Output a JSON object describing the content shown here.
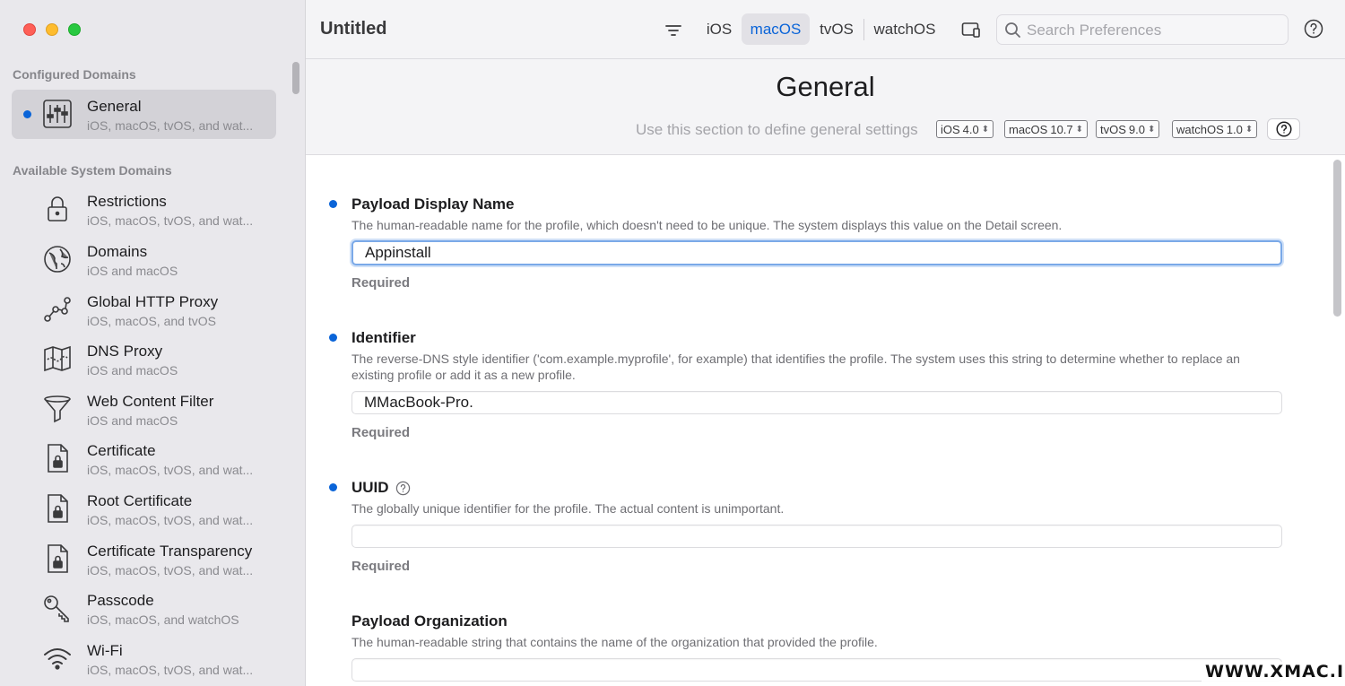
{
  "window": {
    "title": "Untitled"
  },
  "toolbar": {
    "tabs": [
      {
        "label": "iOS",
        "active": false
      },
      {
        "label": "macOS",
        "active": true
      },
      {
        "label": "tvOS",
        "active": false
      },
      {
        "label": "watchOS",
        "active": false
      }
    ],
    "search": {
      "placeholder": "Search Preferences",
      "value": ""
    }
  },
  "sidebar": {
    "configured_heading": "Configured Domains",
    "configured": [
      {
        "title": "General",
        "subtitle": "iOS, macOS, tvOS, and wat...",
        "icon": "sliders-icon",
        "selected": true
      }
    ],
    "available_heading": "Available System Domains",
    "available": [
      {
        "title": "Restrictions",
        "subtitle": "iOS, macOS, tvOS, and wat...",
        "icon": "lock-icon"
      },
      {
        "title": "Domains",
        "subtitle": "iOS and macOS",
        "icon": "globe-icon"
      },
      {
        "title": "Global HTTP Proxy",
        "subtitle": "iOS, macOS, and tvOS",
        "icon": "network-icon"
      },
      {
        "title": "DNS Proxy",
        "subtitle": "iOS and macOS",
        "icon": "map-icon"
      },
      {
        "title": "Web Content Filter",
        "subtitle": "iOS and macOS",
        "icon": "funnel-icon"
      },
      {
        "title": "Certificate",
        "subtitle": "iOS, macOS, tvOS, and wat...",
        "icon": "certificate-icon"
      },
      {
        "title": "Root Certificate",
        "subtitle": "iOS, macOS, tvOS, and wat...",
        "icon": "certificate-icon"
      },
      {
        "title": "Certificate Transparency",
        "subtitle": "iOS, macOS, tvOS, and wat...",
        "icon": "certificate-icon"
      },
      {
        "title": "Passcode",
        "subtitle": "iOS, macOS, and watchOS",
        "icon": "key-icon"
      },
      {
        "title": "Wi-Fi",
        "subtitle": "iOS, macOS, tvOS, and wat...",
        "icon": "wifi-icon"
      }
    ]
  },
  "section": {
    "title": "General",
    "description": "Use this section to define general settings",
    "versions": [
      {
        "os": "iOS",
        "version": "4.0"
      },
      {
        "os": "macOS",
        "version": "10.7"
      },
      {
        "os": "tvOS",
        "version": "9.0"
      },
      {
        "os": "watchOS",
        "version": "1.0"
      }
    ]
  },
  "fields": [
    {
      "label": "Payload Display Name",
      "description": "The human-readable name for the profile, which doesn't need to be unique. The system displays this value on the Detail screen.",
      "value": "Appinstall",
      "required": "Required"
    },
    {
      "label": "Identifier",
      "description": "The reverse-DNS style identifier ('com.example.myprofile', for example) that identifies the profile. The system uses this string to determine whether to replace an existing profile or add it as a new profile.",
      "value": "MMacBook-Pro.",
      "required": "Required"
    },
    {
      "label": "UUID",
      "description": "The globally unique identifier for the profile. The actual content is unimportant.",
      "value": "",
      "required": "Required"
    },
    {
      "label": "Payload Organization",
      "description": "The human-readable string that contains the name of the organization that provided the profile.",
      "value": ""
    }
  ],
  "watermark": "WWW.XMAC.IM",
  "colors": {
    "accent": "#0a64d8",
    "sidebar_bg": "#e9e8ec"
  }
}
